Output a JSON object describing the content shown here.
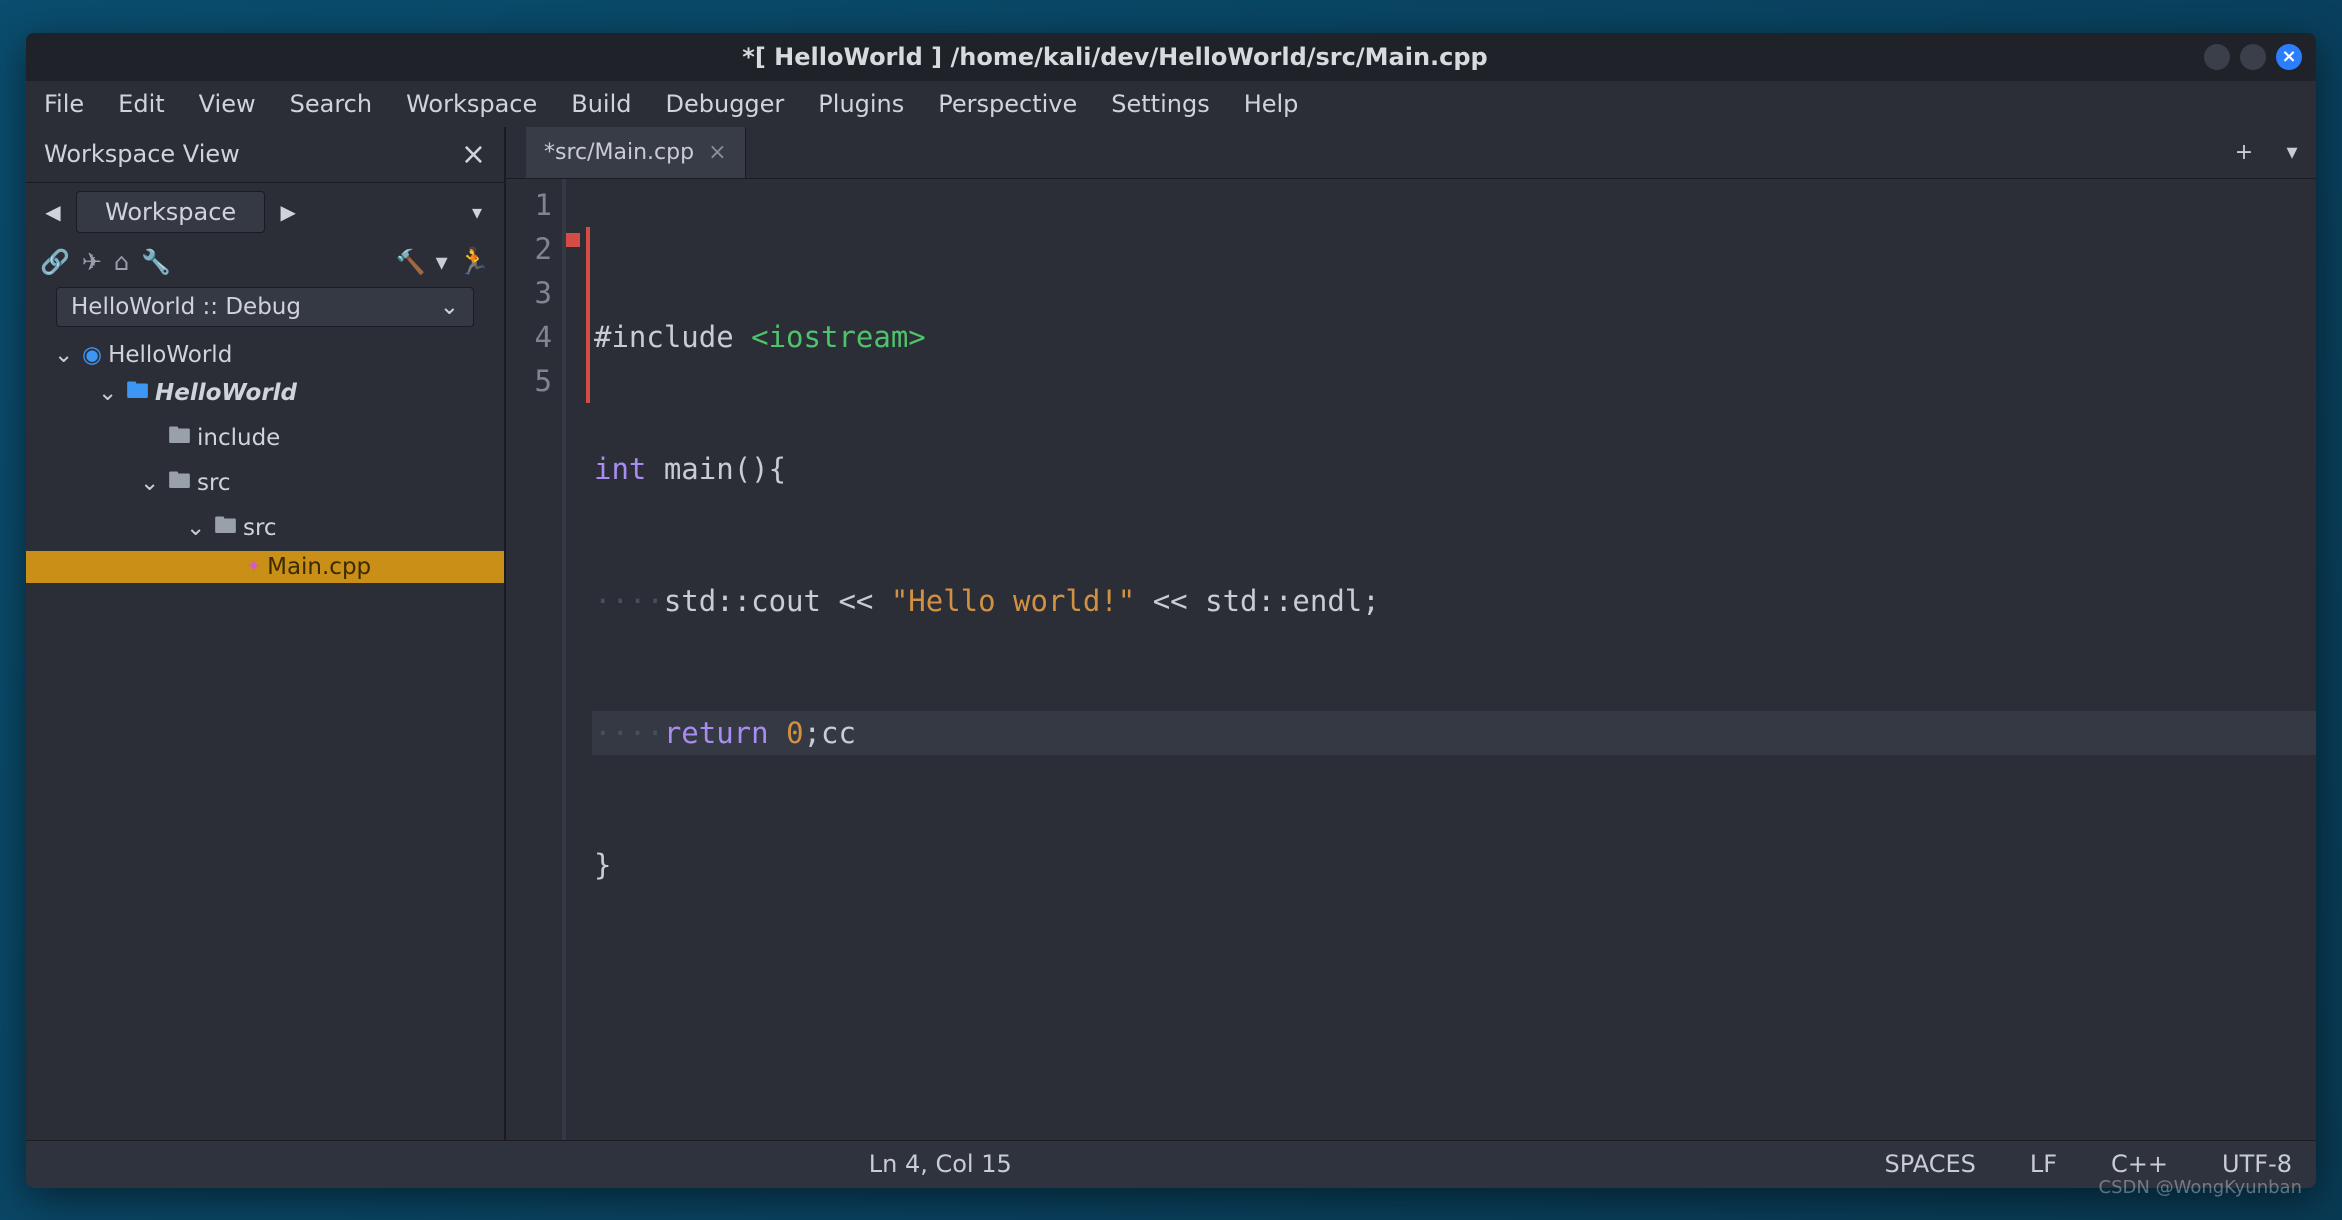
{
  "window": {
    "title": "*[ HelloWorld ] /home/kali/dev/HelloWorld/src/Main.cpp"
  },
  "menu": [
    "File",
    "Edit",
    "View",
    "Search",
    "Workspace",
    "Build",
    "Debugger",
    "Plugins",
    "Perspective",
    "Settings",
    "Help"
  ],
  "sidebar": {
    "panel_title": "Workspace View",
    "nav_label": "Workspace",
    "config_label": "HelloWorld :: Debug",
    "tree": {
      "root": "HelloWorld",
      "project": "HelloWorld",
      "include": "include",
      "src1": "src",
      "src2": "src",
      "file": "Main.cpp"
    }
  },
  "tabs": [
    {
      "label": "*src/Main.cpp"
    }
  ],
  "code": {
    "line_numbers": [
      "1",
      "2",
      "3",
      "4",
      "5"
    ],
    "l1_pre": "#include ",
    "l1_inc": "<iostream>",
    "l2_kw": "int",
    "l2_fn": " main(){",
    "l3_txt": "std::cout << ",
    "l3_str": "\"Hello world!\"",
    "l3_txt2": " << std::endl;",
    "l4_kw": "return",
    "l4_num": " 0",
    "l4_rest": ";cc",
    "l5": "}"
  },
  "status": {
    "pos": "Ln 4, Col 15",
    "indent": "SPACES",
    "eol": "LF",
    "lang": "C++",
    "enc": "UTF-8"
  },
  "watermark": "CSDN @WongKyunban"
}
